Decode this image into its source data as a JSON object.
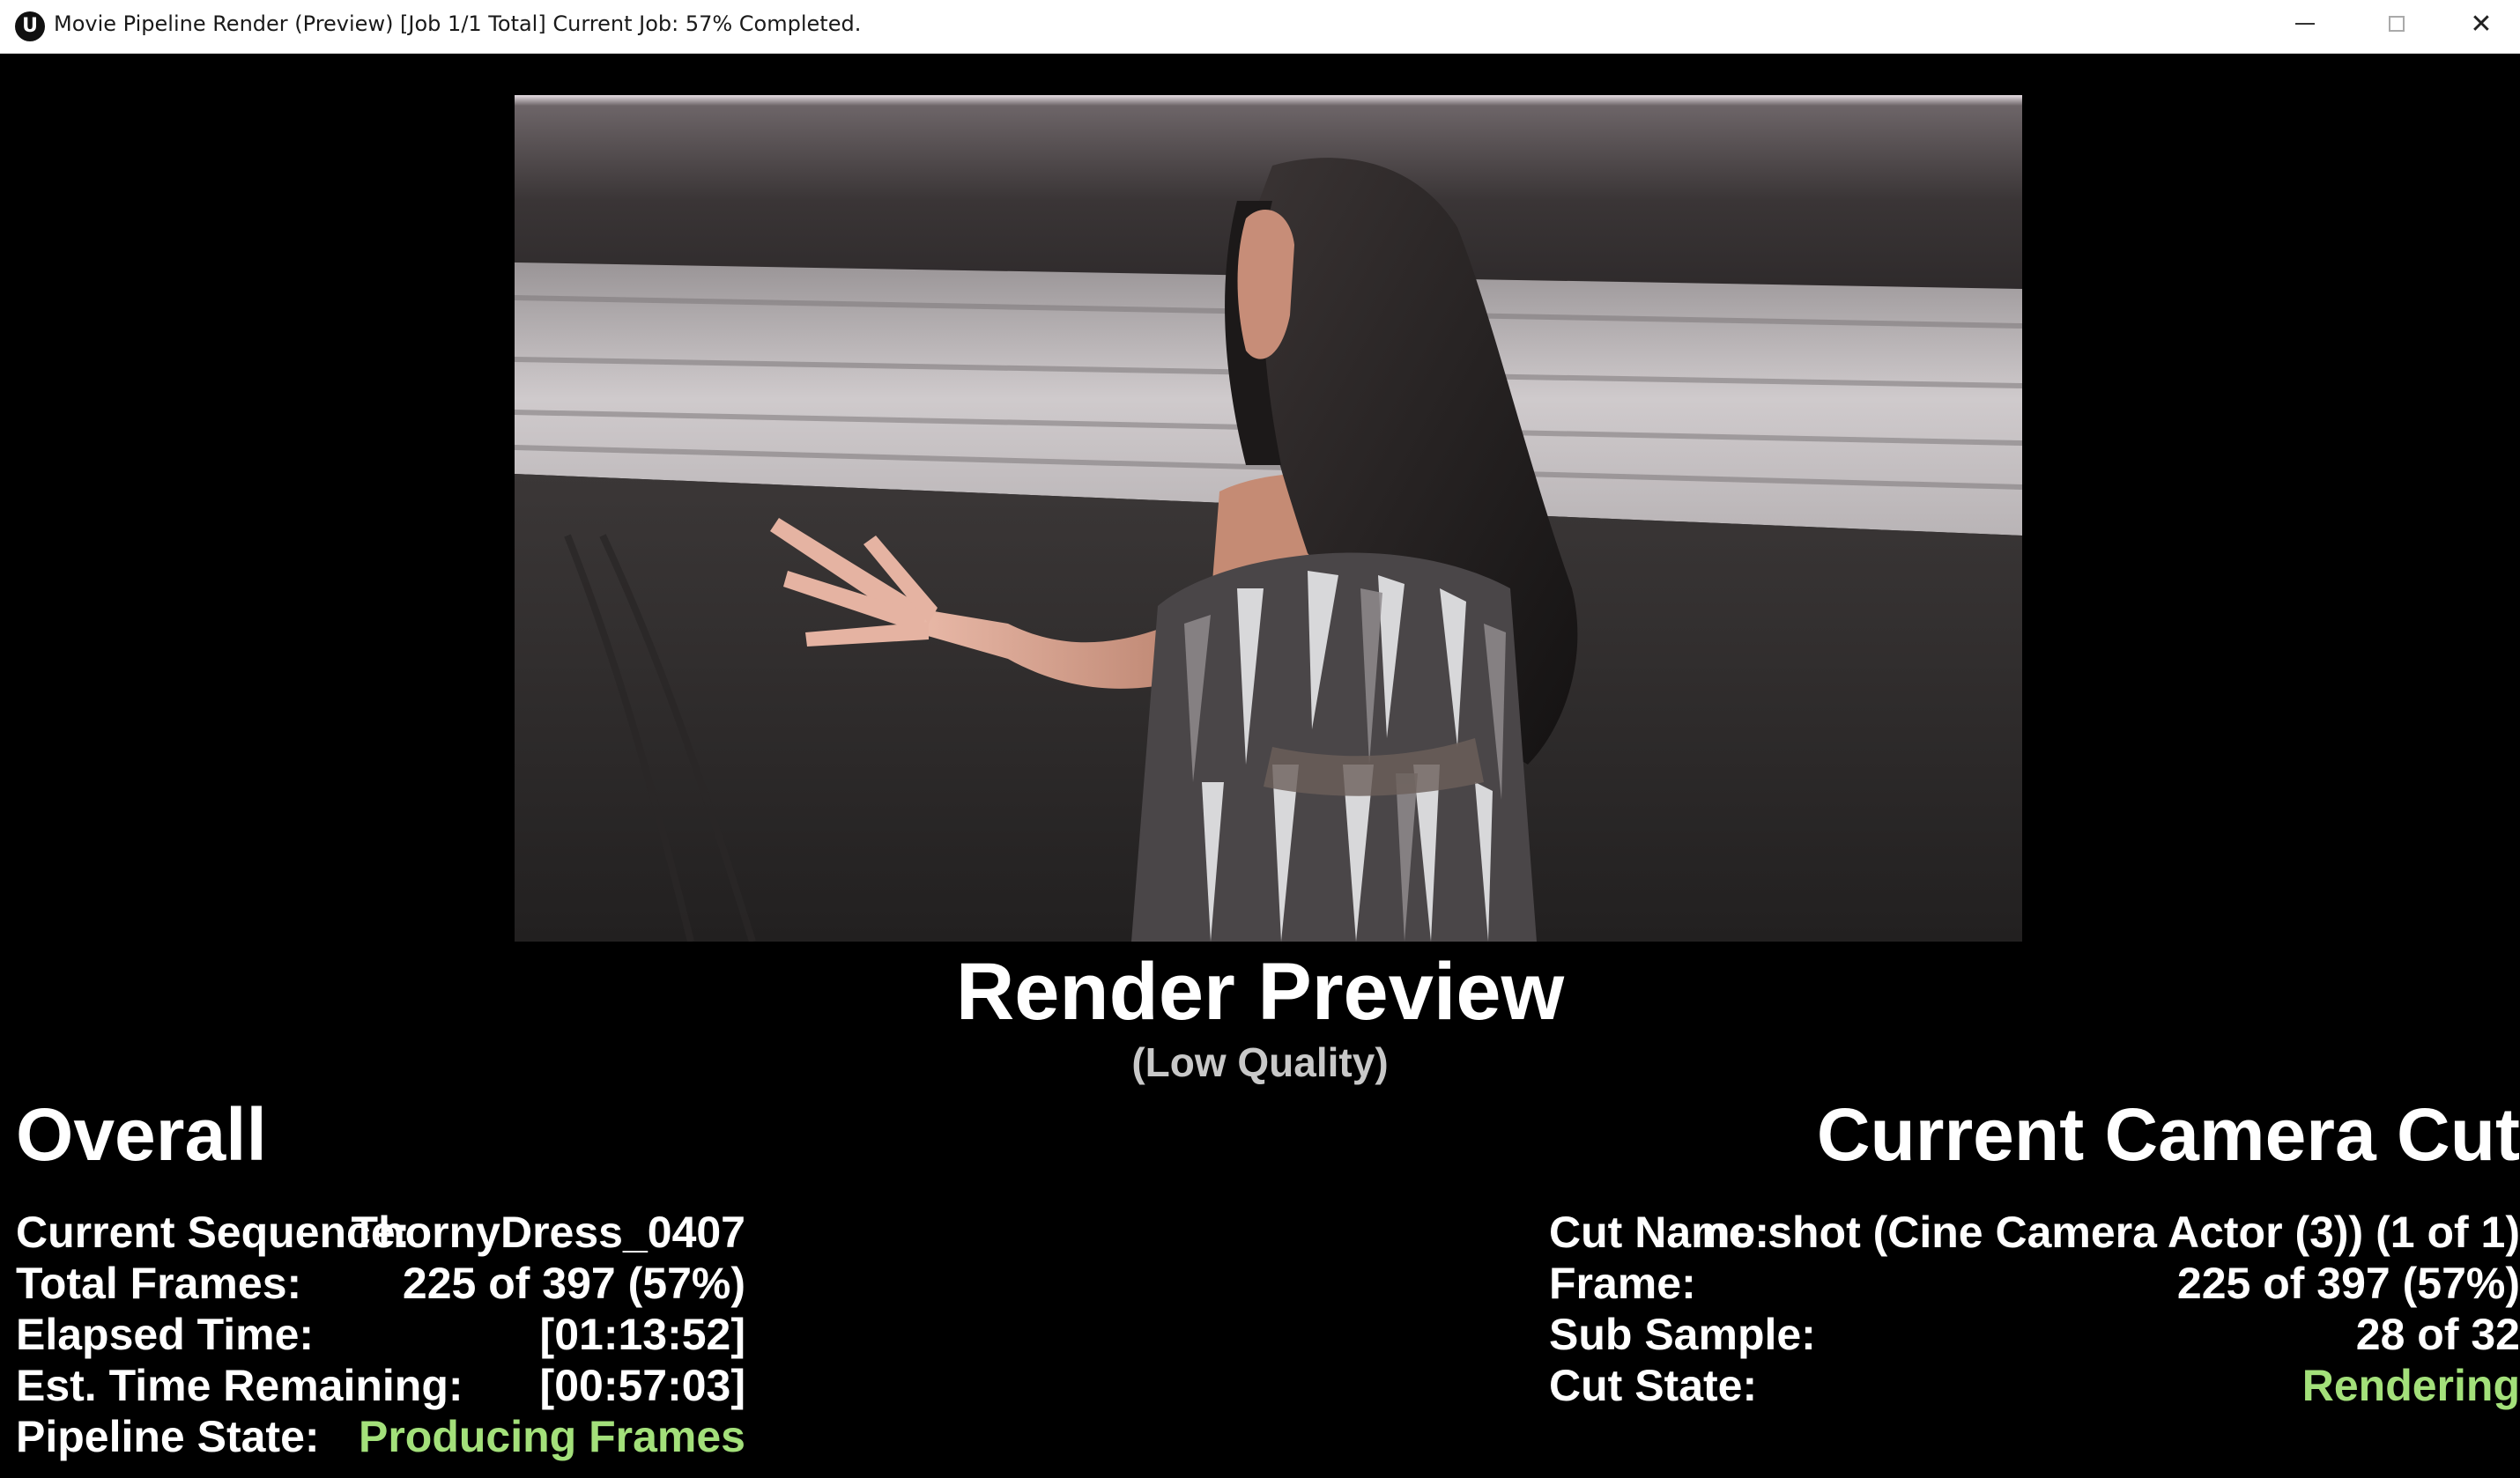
{
  "window": {
    "title": "Movie Pipeline Render (Preview) [Job 1/1 Total] Current Job: 57% Completed.",
    "app_icon": "unreal-engine-logo-icon",
    "controls": {
      "minimize_icon": "minimize-icon",
      "maximize_icon": "maximize-icon",
      "close_icon": "close-icon",
      "close_glyph": "✕"
    }
  },
  "preview": {
    "title": "Render Preview",
    "subtitle": "(Low Quality)"
  },
  "overall": {
    "heading": "Overall",
    "rows": [
      {
        "label": "Current Sequence:",
        "value": "ThornyDress_0407"
      },
      {
        "label": "Total Frames:",
        "value": "225 of 397 (57%)"
      },
      {
        "label": "Elapsed Time:",
        "value": "[01:13:52]"
      },
      {
        "label": "Est. Time Remaining:",
        "value": "[00:57:03]"
      },
      {
        "label": "Pipeline State:",
        "value": "Producing Frames"
      }
    ]
  },
  "camera_cut": {
    "heading": "Current Camera Cut",
    "rows": [
      {
        "label": "Cut Name:",
        "value": "no shot (Cine Camera Actor (3)) (1 of 1)"
      },
      {
        "label": "Frame:",
        "value": "225 of 397 (57%)"
      },
      {
        "label": "Sub Sample:",
        "value": "28 of 32"
      },
      {
        "label": "Cut State:",
        "value": "Rendering"
      }
    ]
  },
  "colors": {
    "background": "#000000",
    "status_green": "#a3e07a",
    "text": "#ffffff",
    "subtitle": "#c8c8c8"
  }
}
